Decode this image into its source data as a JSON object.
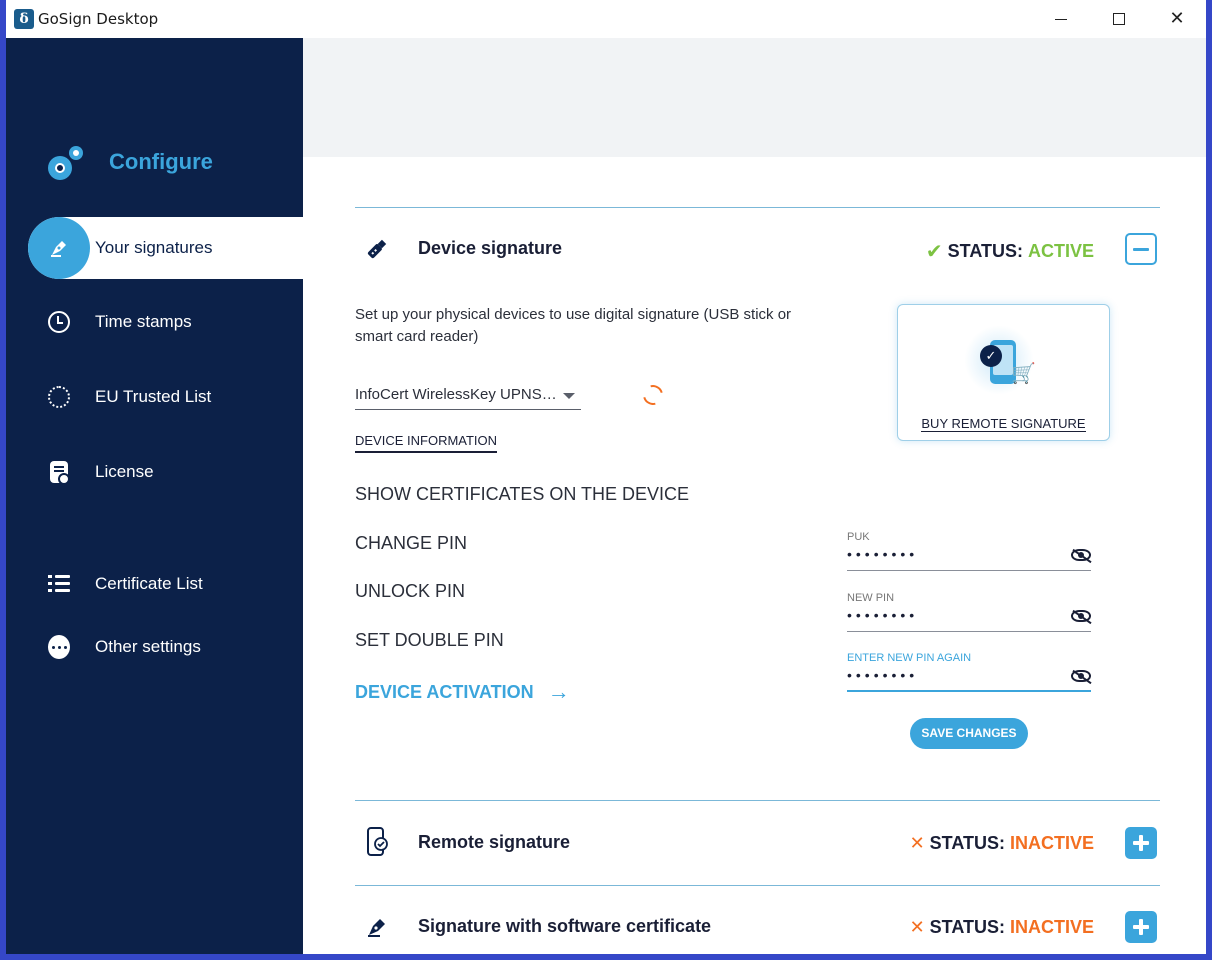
{
  "window": {
    "title": "GoSign Desktop",
    "logo_glyph": "δ"
  },
  "sidebar": {
    "header": "Configure",
    "items": [
      {
        "label": "Your signatures",
        "icon": "pen-nib-icon",
        "active": true
      },
      {
        "label": "Time stamps",
        "icon": "clock-icon"
      },
      {
        "label": "EU Trusted List",
        "icon": "eu-stars-icon"
      },
      {
        "label": "License",
        "icon": "license-icon"
      },
      {
        "label": "Certificate List",
        "icon": "checklist-icon"
      },
      {
        "label": "Other settings",
        "icon": "more-icon"
      }
    ]
  },
  "device_section": {
    "title": "Device signature",
    "status_label": "STATUS:",
    "status_value": "ACTIVE",
    "description": "Set up your physical devices to use digital signature (USB stick or smart card reader)",
    "device_selected": "InfoCert WirelessKey UPNS…",
    "device_info_link": "DEVICE INFORMATION",
    "actions": [
      "SHOW CERTIFICATES ON THE DEVICE",
      "CHANGE PIN",
      "UNLOCK PIN",
      "SET DOUBLE PIN"
    ],
    "activation_link": "DEVICE ACTIVATION",
    "buy_remote_label": "BUY REMOTE SIGNATURE",
    "pin_fields": [
      {
        "label": "PUK",
        "value": "••••••••"
      },
      {
        "label": "NEW PIN",
        "value": "••••••••"
      },
      {
        "label": "ENTER NEW PIN AGAIN",
        "value": "••••••••"
      }
    ],
    "save_label": "SAVE CHANGES"
  },
  "remote_section": {
    "title": "Remote signature",
    "status_label": "STATUS:",
    "status_value": "INACTIVE"
  },
  "software_section": {
    "title": "Signature with software certificate",
    "status_label": "STATUS:",
    "status_value": "INACTIVE"
  },
  "colors": {
    "sidebar_bg": "#0c2149",
    "accent": "#3ba5dc",
    "active_green": "#7cc242",
    "inactive_orange": "#f36f21"
  }
}
